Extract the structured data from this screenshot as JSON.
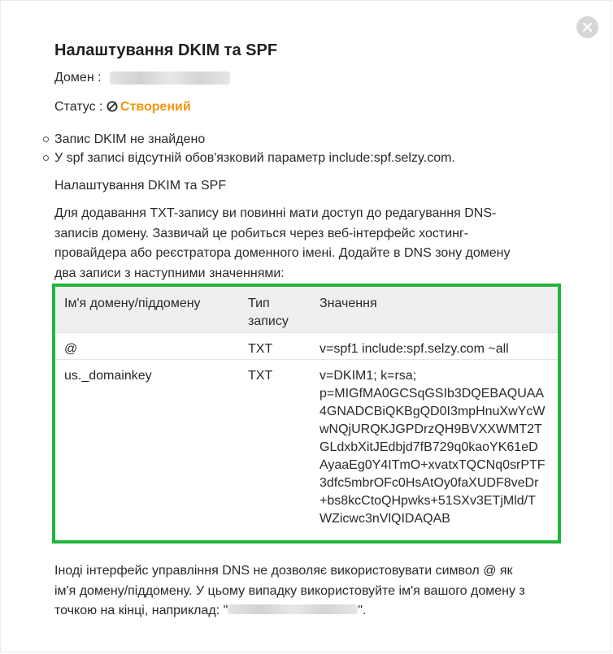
{
  "dialog": {
    "title": "Налаштування DKIM та SPF",
    "domain_label": "Домен :",
    "status_label": "Статус :",
    "status_value": "Створений",
    "status_color": "#f0960e",
    "issues": [
      "Запис DKIM не знайдено",
      "У spf записі відсутній обов'язковий параметр include:spf.selzy.com."
    ],
    "section_heading": "Налаштування DKIM та SPF",
    "instructions_lines": [
      "Для додавання TXT-запису ви повинні мати доступ до редагування DNS-",
      "записів домену. Зазвичай це робиться через веб-інтерфейс хостинг-",
      "провайдера або реєстратора доменного імені. Додайте в DNS зону домену",
      "два записи з наступними значеннями:"
    ],
    "table": {
      "headers": {
        "col1": "Ім'я домену/піддомену",
        "col2_line1": "Тип",
        "col2_line2": "запису",
        "col3": "Значення"
      },
      "rows": [
        {
          "name": "@",
          "type": "TXT",
          "value_lines": [
            "v=spf1 include:spf.selzy.com ~all"
          ]
        },
        {
          "name": "us._domainkey",
          "type": "TXT",
          "value_lines": [
            "v=DKIM1; k=rsa;",
            "p=MIGfMA0GCSqGSIb3DQEBAQUAA",
            "4GNADCBiQKBgQD0I3mpHnuXwYcW",
            "wNQjURQKJGPDrzQH9BVXXWMT2T",
            "GLdxbXitJEdbjd7fB729q0kaoYK61eD",
            "AyaaEg0Y4ITmO+xvatxTQCNq0srPTF",
            "3dfc5mbrOFc0HsAtOy0faXUDF8veDr",
            "+bs8kcCtoQHpwks+51SXv3ETjMld/T",
            "WZicwc3nVlQIDAQAB"
          ]
        }
      ],
      "highlight_color": "#22b53a"
    },
    "footer_lines": [
      "Іноді інтерфейс управління DNS не дозволяє використовувати символ @ як",
      "ім'я домену/піддомену. У цьому випадку використовуйте ім'я вашого домену з",
      "точкою на кінці, наприклад: \"",
      "\"."
    ],
    "close_icon": "close-icon"
  }
}
